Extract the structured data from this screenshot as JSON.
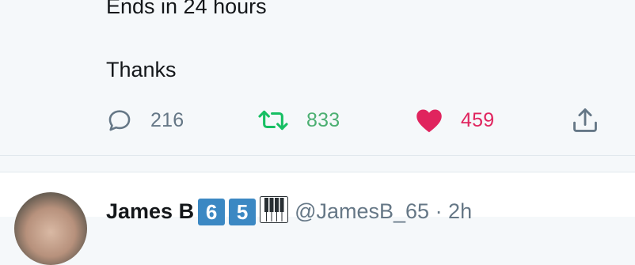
{
  "tweet": {
    "line_ends": "Ends in 24 hours",
    "line_thanks": "Thanks",
    "actions": {
      "reply_icon": "comment-bubble-icon",
      "reply_count": "216",
      "retweet_icon": "retweet-arrows-icon",
      "retweet_count": "833",
      "like_icon": "heart-filled-icon",
      "like_count": "459",
      "share_icon": "share-upload-icon"
    },
    "colors": {
      "neutral": "#657786",
      "retweet": "#17bf63",
      "like": "#e0245e"
    }
  },
  "next_tweet": {
    "display_name": "James B",
    "badges": [
      "6",
      "5"
    ],
    "piano_icon": "piano-keys-icon",
    "meta": "@JamesB_65 · 2h",
    "badge_color": "#3b88c3"
  }
}
